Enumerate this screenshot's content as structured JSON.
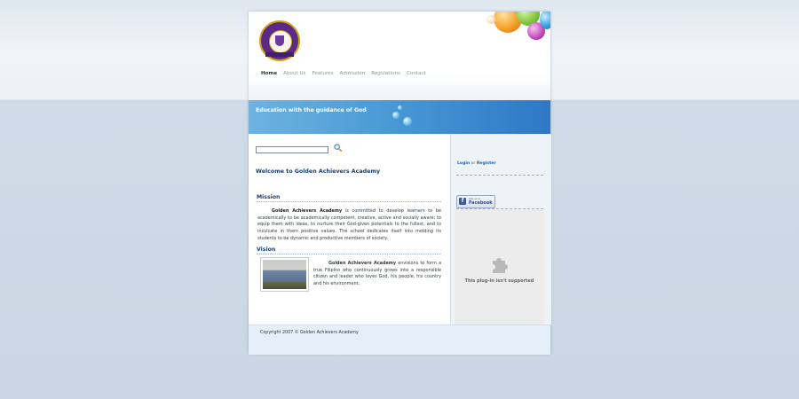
{
  "nav": {
    "items": [
      {
        "label": "Home",
        "active": true
      },
      {
        "label": "About Us"
      },
      {
        "label": "Features"
      },
      {
        "label": "Admission"
      },
      {
        "label": "Regulations"
      },
      {
        "label": "Contact"
      }
    ]
  },
  "banner": {
    "tagline": "Education with the guidance of God"
  },
  "main": {
    "welcome": "Welcome to Golden Achievers Academy",
    "mission": {
      "heading": "Mission",
      "org": "Golden Achievers Academy",
      "text": " is committed to develop learners to be academically to be academically competent, creative, active and socially aware; to equip them with ideas, to nurture their God-given potentials to the fullest, and to inculcate in them positive values. The school dedicates itself into molding its students to be dynamic and productive members of society."
    },
    "vision": {
      "heading": "Vision",
      "org": "Golden Achievers Academy",
      "text": " envisions to form a true Filipino who continuously grows into a responsible citizen and leader who loves God, his people, his country and his environment."
    }
  },
  "sidebar": {
    "login": "Login",
    "or": " or ",
    "register": "Register",
    "fb_small": "Like us on",
    "fb_label": "Facebook",
    "plugin_message": "This plug-in isn't supported"
  },
  "footer": {
    "copyright": "Copyright 2007 © Golden Achievers Academy"
  },
  "colors": {
    "accent": "#1f3f66",
    "banner": "#4a9ad6",
    "link": "#1b64b4"
  }
}
